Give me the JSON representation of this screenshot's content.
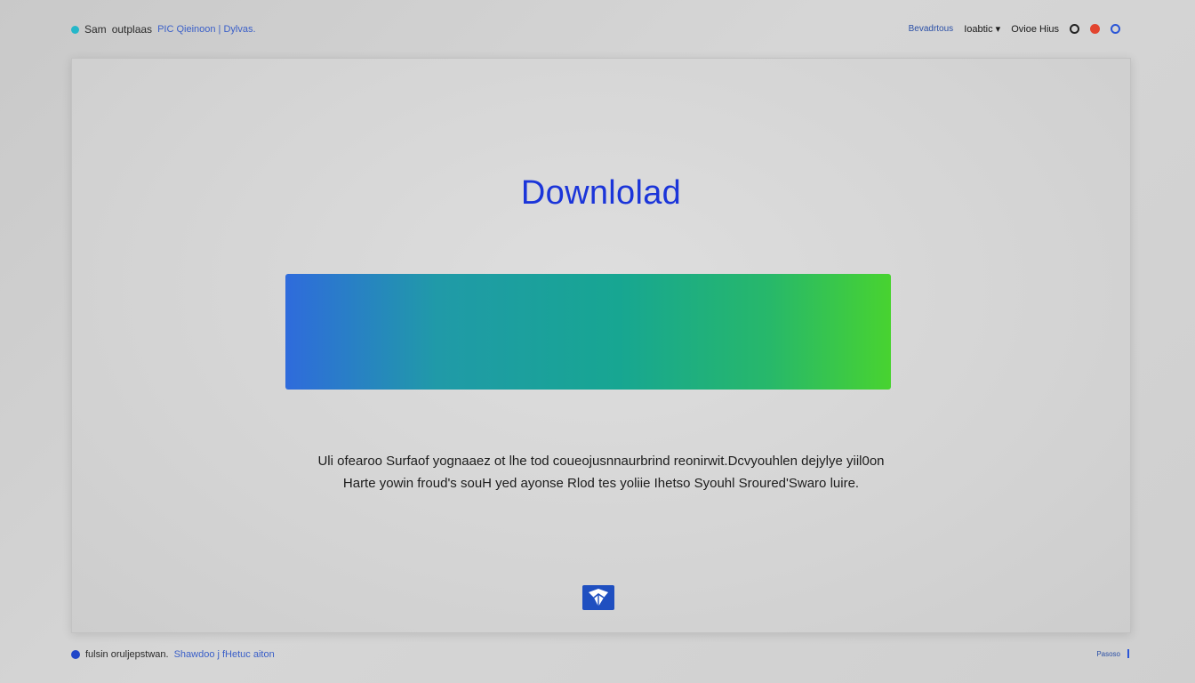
{
  "topbar": {
    "left_app": "Sam",
    "left_text": "outplaas",
    "left_link": "PIC Qieinoon | Dylvas.",
    "right_small": "Bevadrtous",
    "right_menu": "Ioabtic",
    "right_menu_caret": "▾",
    "right_link": "Ovioe Hius",
    "icons": [
      "ring-icon",
      "red-dot-icon",
      "blue-ring-icon"
    ]
  },
  "main": {
    "title": "Downlolad",
    "description_line1": "Uli ofearoo Surfaof yognaaez ot lhe tod coueojusnnaurbrind reonirwit.Dcvyouhlen dejylye yiil0on",
    "description_line2": "Harte yowin froud's souH yed ayonse  Rlod tes yoliie Ihetso Syouhl Sroured'Swaro luire.",
    "bar_gradient": [
      "#2f6bdc",
      "#17a692",
      "#48d330"
    ],
    "logo_icon": "app-logo-icon"
  },
  "footer": {
    "left_text": "fulsin oruljepstwan.",
    "left_link": "Shawdoo j fHetuc aiton",
    "right_small": "Pasoso"
  },
  "colors": {
    "accent_title": "#1b35d9",
    "brand_blue": "#1f4fc0",
    "background": "#d4d4d4"
  }
}
